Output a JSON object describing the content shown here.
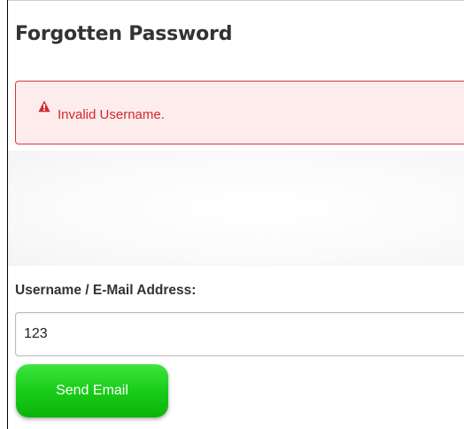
{
  "page": {
    "title": "Forgotten Password"
  },
  "alert": {
    "icon": "warning-triangle-icon",
    "message": "Invalid Username.",
    "color": "#d4282e",
    "background": "#fdecec"
  },
  "form": {
    "field_label": "Username / E-Mail Address:",
    "username_value": "123",
    "submit_label": "Send Email",
    "submit_color": "#19cc19"
  }
}
